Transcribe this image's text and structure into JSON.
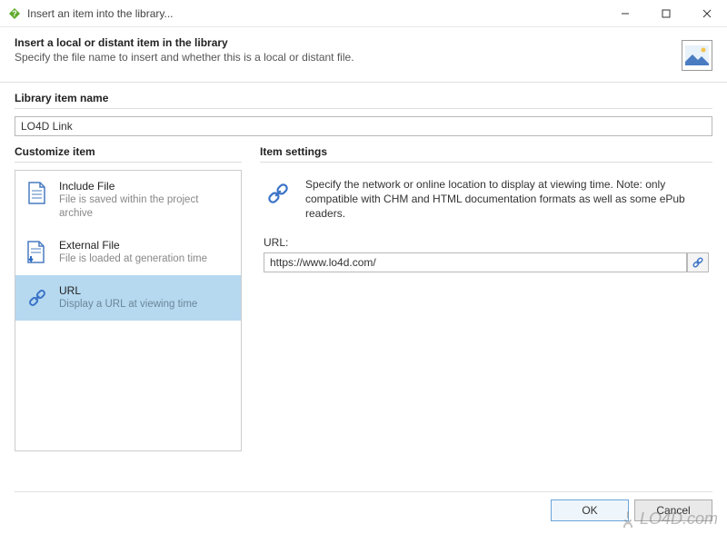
{
  "window": {
    "title": "Insert an item into the library..."
  },
  "header": {
    "title": "Insert a local or distant item in the library",
    "subtitle": "Specify the file name to insert and whether this is a local or distant file."
  },
  "library_name": {
    "label": "Library item name",
    "value": "LO4D Link"
  },
  "customize": {
    "label": "Customize item",
    "items": [
      {
        "title": "Include File",
        "desc": "File is saved within the project archive",
        "icon": "file-icon",
        "selected": false
      },
      {
        "title": "External File",
        "desc": "File is loaded at generation time",
        "icon": "file-download-icon",
        "selected": false
      },
      {
        "title": "URL",
        "desc": "Display a URL at viewing time",
        "icon": "link-icon",
        "selected": true
      }
    ]
  },
  "settings": {
    "label": "Item settings",
    "description": "Specify the network or online location to display at viewing time. Note: only compatible with CHM and HTML documentation formats as well as some ePub readers.",
    "url_label": "URL:",
    "url_value": "https://www.lo4d.com/"
  },
  "buttons": {
    "ok": "OK",
    "cancel": "Cancel"
  },
  "watermark": "LO4D.com",
  "colors": {
    "accent": "#3b73c7",
    "selection": "#b6d9f0"
  }
}
